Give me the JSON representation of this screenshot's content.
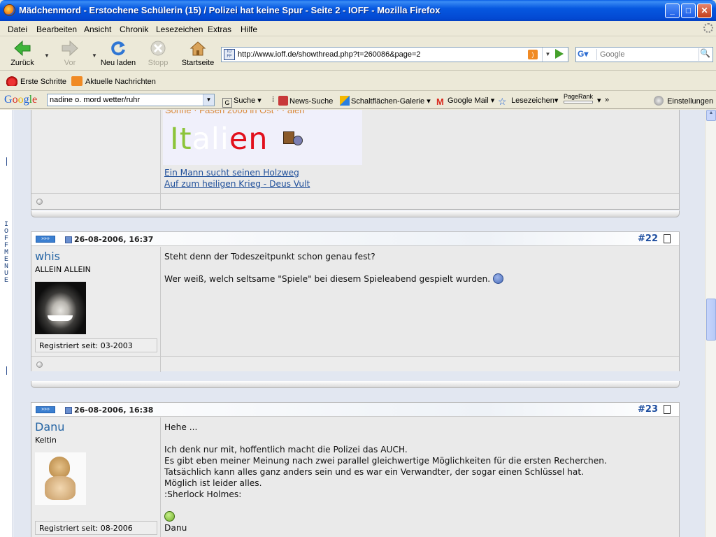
{
  "window": {
    "title": "Mädchenmord - Erstochene Schülerin (15) / Polizei hat keine Spur - Seite 2 - IOFF - Mozilla Firefox"
  },
  "menu": [
    "Datei",
    "Bearbeiten",
    "Ansicht",
    "Chronik",
    "Lesezeichen",
    "Extras",
    "Hilfe"
  ],
  "nav": {
    "back": "Zurück",
    "forward": "Vor",
    "reload": "Neu laden",
    "stop": "Stopp",
    "home": "Startseite",
    "url": "http://www.ioff.de/showthread.php?t=260086&page=2",
    "search_placeholder": "Google"
  },
  "bookmarks": [
    "Erste Schritte",
    "Aktuelle Nachrichten"
  ],
  "google_toolbar": {
    "logo": "Google",
    "query": "nadine o. mord wetter/ruhr",
    "items": [
      "Suche",
      "News-Suche",
      "Schaltflächen-Galerie",
      "Google Mail",
      "Lesezeichen",
      "PageRank",
      "»",
      "Einstellungen"
    ]
  },
  "left_rail": {
    "menu_label": "IOFF MENUE"
  },
  "prev_post": {
    "signature_partial": "Sonne · Fasen 2006 in Ost · ·  alen",
    "italien_letters": [
      "I",
      "t",
      "a",
      "l",
      "i",
      "e",
      "n"
    ],
    "links": [
      "Ein Mann sucht seinen Holzweg",
      "Auf zum heiligen Krieg - Deus Vult"
    ]
  },
  "posts": [
    {
      "date": "26-08-2006, 16:37",
      "number": "#22",
      "username": "whis",
      "user_title": "ALLEIN ALLEIN",
      "registered": "Registriert seit: 03-2003",
      "lines": [
        "Steht denn der Todeszeitpunkt schon genau fest?",
        "",
        "Wer weiß, welch seltsame \"Spiele\" bei diesem Spieleabend gespielt wurden."
      ]
    },
    {
      "date": "26-08-2006, 16:38",
      "number": "#23",
      "username": "Danu",
      "user_title": "Keltin",
      "registered": "Registriert seit: 08-2006",
      "lines": [
        "Hehe ...",
        "",
        "Ich denk nur mit, hoffentlich macht die Polizei das AUCH.",
        "Es gibt eben meiner Meinung nach zwei parallel gleichwertige Möglichkeiten für die ersten Recherchen.",
        "Tatsächlich kann alles ganz anders sein und es war ein Verwandter, der sogar einen Schlüssel hat.",
        "Möglich ist leider alles.",
        ":Sherlock Holmes:",
        "",
        "",
        "Danu"
      ]
    }
  ]
}
